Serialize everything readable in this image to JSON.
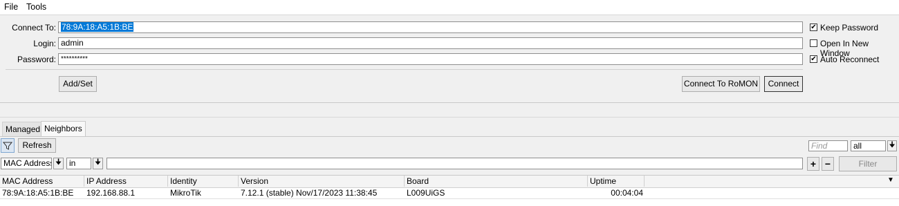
{
  "menu": {
    "file": "File",
    "tools": "Tools"
  },
  "form": {
    "connect_to_label": "Connect To:",
    "connect_to_value": "78:9A:18:A5:1B:BE",
    "login_label": "Login:",
    "login_value": "admin",
    "password_label": "Password:",
    "password_value": "**********",
    "keep_password_label": "Keep Password",
    "keep_password_checked": true,
    "open_new_window_label": "Open In New Window",
    "open_new_window_checked": false,
    "auto_reconnect_label": "Auto Reconnect",
    "auto_reconnect_checked": true,
    "add_set": "Add/Set",
    "connect_romon": "Connect To RoMON",
    "connect": "Connect"
  },
  "tabs": {
    "managed": "Managed",
    "neighbors": "Neighbors"
  },
  "toolbar": {
    "refresh": "Refresh",
    "find_placeholder": "Find",
    "find_scope": "all"
  },
  "filter": {
    "field": "MAC Address",
    "operator": "in",
    "value": "",
    "plus": "+",
    "minus": "−",
    "filter_button": "Filter"
  },
  "table": {
    "headers": {
      "mac": "MAC Address",
      "ip": "IP Address",
      "identity": "Identity",
      "version": "Version",
      "board": "Board",
      "uptime": "Uptime"
    },
    "rows": [
      {
        "mac": "78:9A:18:A5:1B:BE",
        "ip": "192.168.88.1",
        "identity": "MikroTik",
        "version": "7.12.1 (stable) Nov/17/2023 11:38:45",
        "board": "L009UiGS",
        "uptime": "00:04:04"
      }
    ]
  }
}
